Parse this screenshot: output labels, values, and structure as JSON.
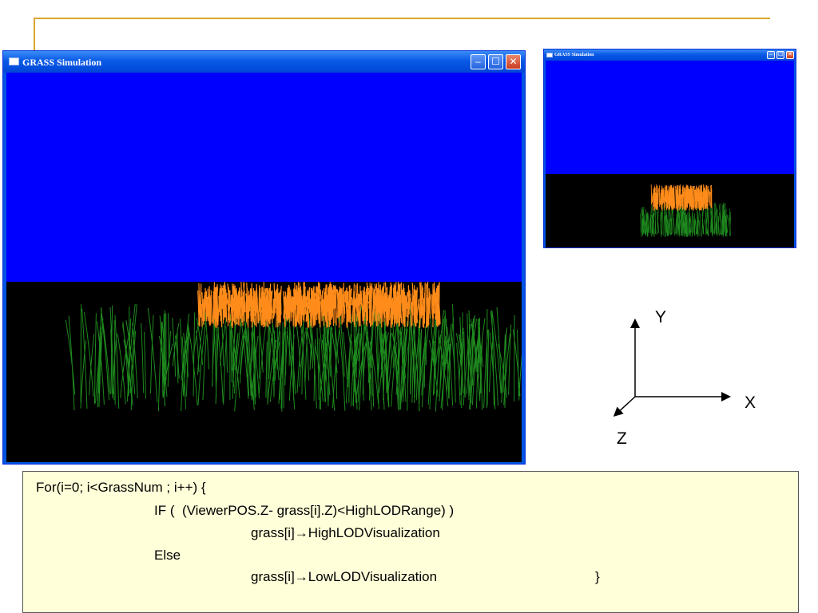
{
  "main_window": {
    "title": "GRASS Simulation",
    "minimize_glyph": "–",
    "maximize_glyph": "☐",
    "close_glyph": "✕",
    "icon": "window-app-icon"
  },
  "small_window": {
    "title": "GRASS Simulation",
    "minimize_glyph": "–",
    "maximize_glyph": "☐",
    "close_glyph": "✕",
    "icon": "window-app-icon"
  },
  "scene_colors": {
    "sky": "#0000ff",
    "ground": "#000000",
    "grass_near": "#1e8a1e",
    "grass_far": "#ff8c1a"
  },
  "axes": {
    "y_label": "Y",
    "x_label": "X",
    "z_label": "Z"
  },
  "code": {
    "lines": [
      "For(i=0; i<GrassNum ; i++) {",
      "IF (  (ViewerPOS.Z- grass[i].Z)<HighLODRange) )",
      "grass[i]→HighLODVisualization",
      "Else",
      "grass[i]→LowLODVisualization",
      "}"
    ]
  },
  "accent_colors": {
    "decor_line": "#d9a62b",
    "code_background": "#ffffd9",
    "titlebar": "#0a5ae6"
  }
}
